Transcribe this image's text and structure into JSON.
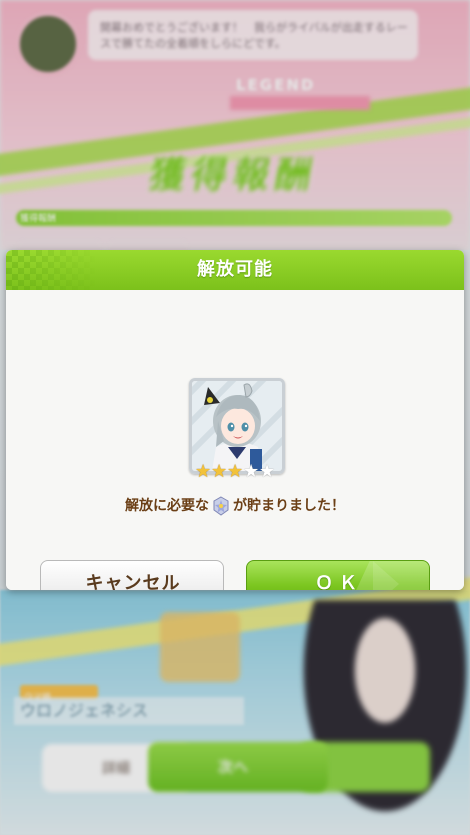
{
  "background": {
    "bubble_text": "開幕おめでとうございます！　我らがライバルが出走するレースで勝てたの全着順をしらにどです。",
    "legend_label": "LEGEND",
    "big_title": "獲得報酬",
    "progress_label": "獲得報酬",
    "name_tag_label": "ウマ娘",
    "name_tag_name": "ウロノジェネシス",
    "button_left": "詳細",
    "button_center": "次へ"
  },
  "dialog": {
    "title": "解放可能",
    "rarity_filled": 3,
    "rarity_total": 5,
    "message_before": "解放に必要な",
    "message_after": "が貯まりました！",
    "piece_icon": "piece-icon",
    "cancel_label": "キャンセル",
    "ok_label": "ＯＫ"
  },
  "colors": {
    "header_green": "#8bcd24",
    "ok_green": "#7cc620",
    "message_brown": "#6b3f16",
    "star_gold": "#f2c23a"
  }
}
